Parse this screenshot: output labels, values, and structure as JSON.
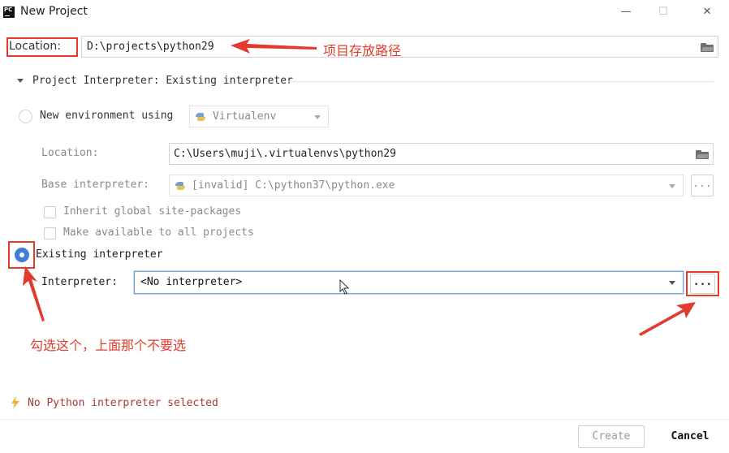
{
  "window": {
    "title": "New Project",
    "minimize": "—",
    "maximize": "☐",
    "close": "✕"
  },
  "location": {
    "label": "Location:",
    "value": "D:\\projects\\python29"
  },
  "interpreter_section": {
    "label": "Project Interpreter: Existing interpreter"
  },
  "new_env": {
    "radio_label": "New environment using",
    "tool": "Virtualenv",
    "location_label": "Location:",
    "location_value": "C:\\Users\\muji\\.virtualenvs\\python29",
    "base_label": "Base interpreter:",
    "base_value": "[invalid] C:\\python37\\python.exe",
    "browse": "...",
    "inherit_label": "Inherit global site-packages",
    "available_label": "Make available to all projects"
  },
  "existing": {
    "radio_label": "Existing interpreter",
    "interpreter_label": "Interpreter:",
    "interpreter_value": "<No interpreter>",
    "browse": "..."
  },
  "annotations": {
    "path_note": "项目存放路径",
    "select_note": "勾选这个，上面那个不要选"
  },
  "status": {
    "message": "No Python interpreter selected"
  },
  "buttons": {
    "create": "Create",
    "cancel": "Cancel"
  },
  "colors": {
    "annotation_red": "#e33a2e",
    "accent_blue": "#3d7ed6",
    "warning_yellow": "#f0b42a",
    "error_text": "#a43b3b"
  }
}
